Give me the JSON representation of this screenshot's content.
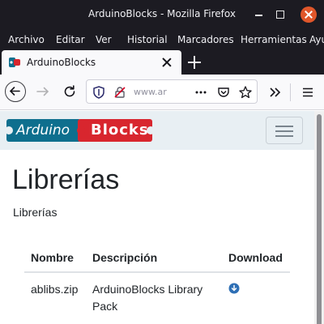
{
  "window": {
    "title": "ArduinoBlocks - Mozilla Firefox"
  },
  "menu": [
    "Archivo",
    "Editar",
    "Ver",
    "Historial",
    "Marcadores",
    "Herramientas",
    "Ayuda"
  ],
  "tab": {
    "title": "ArduinoBlocks"
  },
  "urlbar": {
    "text": "www.ar"
  },
  "site": {
    "logo": {
      "part1": "Arduino",
      "part2": "Blocks"
    },
    "heading": "Librerías",
    "lead": "Librerías"
  },
  "table": {
    "headers": [
      "Nombre",
      "Descripción",
      "Download"
    ],
    "rows": [
      {
        "name": "ablibs.zip",
        "description_line1": "ArduinoBlocks Library",
        "description_line2": "Pack"
      }
    ]
  },
  "colors": {
    "logo_blue": "#0e6f8e",
    "logo_red": "#d8262e",
    "download_icon": "#2e6fb5"
  },
  "icons": [
    "arduinoblocks-favicon",
    "back-arrow-icon",
    "forward-arrow-icon",
    "reload-icon",
    "shield-icon",
    "insecure-lock-icon",
    "more-dots-icon",
    "pocket-icon",
    "bookmark-star-icon",
    "overflow-chevrons-icon",
    "hamburger-menu-icon",
    "download-circle-icon"
  ]
}
